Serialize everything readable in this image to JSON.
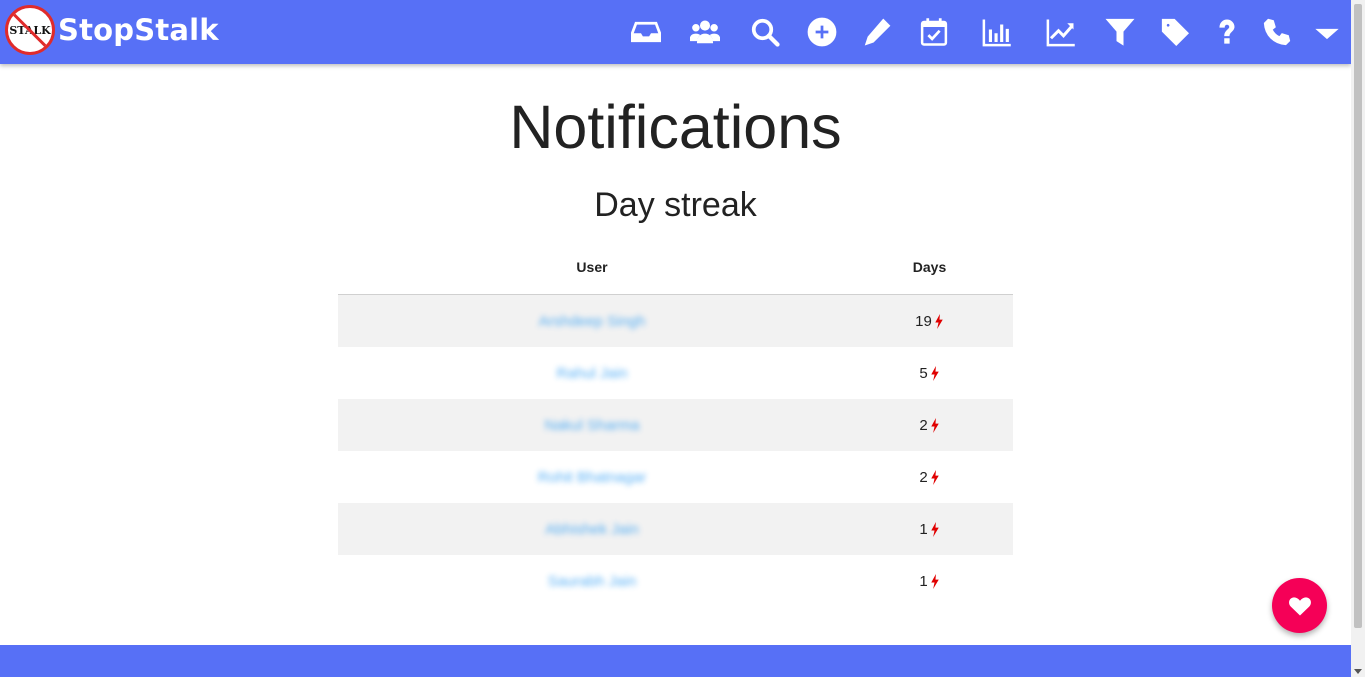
{
  "brand": {
    "logo_text": "STALK",
    "name": "StopStalk",
    "colors": {
      "navbar": "#5770f6",
      "logo_ring": "#e02b2b"
    }
  },
  "nav": {
    "icons": [
      "inbox-icon",
      "users-icon",
      "search-icon",
      "plus-circle-icon",
      "pencil-icon",
      "calendar-check-icon",
      "bar-chart-icon",
      "line-chart-icon",
      "filter-icon",
      "tag-icon",
      "question-icon",
      "phone-icon",
      "caret-down-icon"
    ]
  },
  "page": {
    "title": "Notifications",
    "section_title": "Day streak"
  },
  "table": {
    "headers": {
      "user": "User",
      "days": "Days"
    },
    "rows": [
      {
        "user": "Arshdeep Singh",
        "days": "19"
      },
      {
        "user": "Rahul Jain",
        "days": "5"
      },
      {
        "user": "Nakul Sharma",
        "days": "2"
      },
      {
        "user": "Rohit Bhatnagar",
        "days": "2"
      },
      {
        "user": "Abhishek Jain",
        "days": "1"
      },
      {
        "user": "Saurabh Jain",
        "days": "1"
      }
    ],
    "streak_icon": "lightning-bolt-icon",
    "colors": {
      "link": "#2196f3",
      "bolt": "#e00000",
      "stripe": "#f2f2f2"
    }
  },
  "fab": {
    "icon": "heart-icon",
    "color": "#f50057"
  }
}
